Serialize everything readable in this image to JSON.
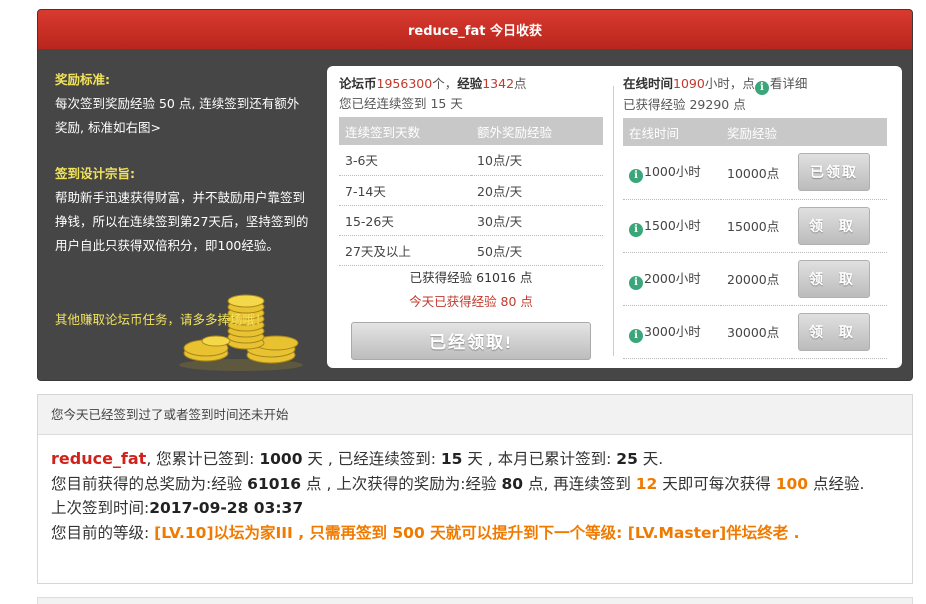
{
  "panel": {
    "title": "reduce_fat 今日收获",
    "reward_title": "奖励标准:",
    "reward_text": "每次签到奖励经验 50 点, 连续签到还有额外奖励, 标准如右图>",
    "design_title": "签到设计宗旨:",
    "design_text": "帮助新手迅速获得财富，并不鼓励用户靠签到挣钱，所以在连续签到第27天后，坚持签到的用户自此只获得双倍积分，即100经验。",
    "more_tasks": "其他赚取论坛币任务，请多多捧场哦！"
  },
  "signin": {
    "coins_label": "论坛币",
    "coins_value": "1956300",
    "coins_unit": "个，",
    "exp_label": "经验",
    "exp_value": "1342",
    "exp_unit": "点",
    "streak_text": "您已经连续签到 15 天",
    "table_headers": [
      "连续签到天数",
      "额外奖励经验"
    ],
    "rows": [
      {
        "days": "3-6天",
        "bonus": "10点/天"
      },
      {
        "days": "7-14天",
        "bonus": "20点/天"
      },
      {
        "days": "15-26天",
        "bonus": "30点/天"
      },
      {
        "days": "27天及以上",
        "bonus": "50点/天"
      }
    ],
    "total_exp": "已获得经验 61016 点",
    "today_exp": "今天已获得经验 80 点",
    "claimed_button": "已经领取!"
  },
  "online": {
    "time_label": "在线时间",
    "time_value": "1090",
    "time_unit": "小时，点",
    "details_link": "看详细",
    "earned_text": "已获得经验 29290 点",
    "table_headers": [
      "在线时间",
      "奖励经验"
    ],
    "rows": [
      {
        "hours": "1000小时",
        "exp": "10000点",
        "button": "已领取"
      },
      {
        "hours": "1500小时",
        "exp": "15000点",
        "button": "领 取"
      },
      {
        "hours": "2000小时",
        "exp": "20000点",
        "button": "领 取"
      },
      {
        "hours": "3000小时",
        "exp": "30000点",
        "button": "领 取"
      }
    ]
  },
  "notice": {
    "header": "您今天已经签到过了或者签到时间还未开始",
    "username": "reduce_fat",
    "line1_a": ", 您累计已签到: ",
    "total_days": "1000",
    "line1_b": " 天 , 已经连续签到: ",
    "streak_days": "15",
    "line1_c": " 天 , 本月已累计签到: ",
    "month_days": "25",
    "line1_d": " 天.",
    "line2_a": "您目前获得的总奖励为:经验 ",
    "total_reward": "61016",
    "line2_b": " 点 , 上次获得的奖励为:经验 ",
    "last_reward": "80",
    "line2_c": " 点, 再连续签到 ",
    "need_days": "12",
    "line2_d": " 天即可每次获得 ",
    "per_reward": "100",
    "line2_e": " 点经验.",
    "last_time_label": "上次签到时间:",
    "last_time": "2017-09-28 03:37",
    "level_label": "您目前的等级: ",
    "level_text": "[LV.10]以坛为家III , 只需再签到 500 天就可以提升到下一个等级: [LV.Master]伴坛终老 ."
  }
}
